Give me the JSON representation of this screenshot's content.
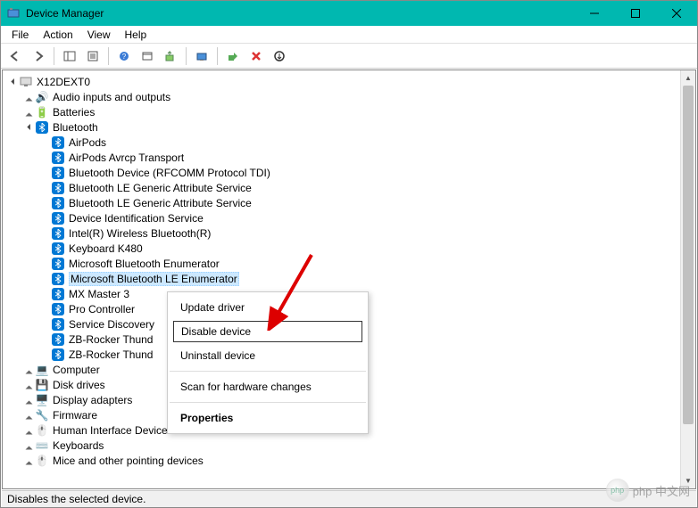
{
  "window": {
    "title": "Device Manager"
  },
  "menu": {
    "file": "File",
    "action": "Action",
    "view": "View",
    "help": "Help"
  },
  "tree": {
    "root": "X12DEXT0",
    "categories": {
      "audio": "Audio inputs and outputs",
      "batteries": "Batteries",
      "bluetooth": "Bluetooth",
      "computer": "Computer",
      "disks": "Disk drives",
      "display": "Display adapters",
      "firmware": "Firmware",
      "hid": "Human Interface Devices",
      "keyboards": "Keyboards",
      "mice": "Mice and other pointing devices"
    },
    "bluetooth_devices": [
      "AirPods",
      "AirPods Avrcp Transport",
      "Bluetooth Device (RFCOMM Protocol TDI)",
      "Bluetooth LE Generic Attribute Service",
      "Bluetooth LE Generic Attribute Service",
      "Device Identification Service",
      "Intel(R) Wireless Bluetooth(R)",
      "Keyboard K480",
      "Microsoft Bluetooth Enumerator",
      "Microsoft Bluetooth LE Enumerator",
      "MX Master 3",
      "Pro Controller",
      "Service Discovery",
      "ZB-Rocker Thund",
      "ZB-Rocker Thund"
    ],
    "selected_index": 9
  },
  "context_menu": {
    "update": "Update driver",
    "disable": "Disable device",
    "uninstall": "Uninstall device",
    "scan": "Scan for hardware changes",
    "properties": "Properties"
  },
  "statusbar": {
    "text": "Disables the selected device."
  },
  "watermark": {
    "text": "php 中文网"
  }
}
